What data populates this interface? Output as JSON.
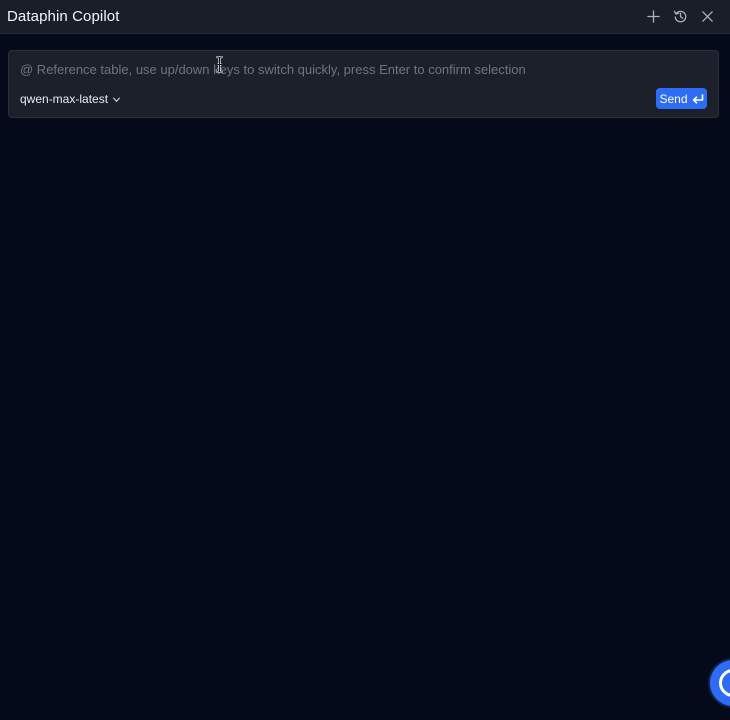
{
  "header": {
    "title": "Dataphin Copilot",
    "actions": [
      {
        "name": "new-chat",
        "icon": "plus-icon"
      },
      {
        "name": "history",
        "icon": "history-icon"
      },
      {
        "name": "close",
        "icon": "close-icon"
      }
    ]
  },
  "composer": {
    "placeholder": "@ Reference table, use up/down keys to switch quickly, press Enter to confirm selection",
    "value": "",
    "model": "qwen-max-latest",
    "send_label": "Send"
  },
  "colors": {
    "background": "#050a1a",
    "header": "#1a1e28",
    "composer": "#1c202a",
    "accent": "#2f6cf6",
    "placeholder": "#6e7483"
  }
}
